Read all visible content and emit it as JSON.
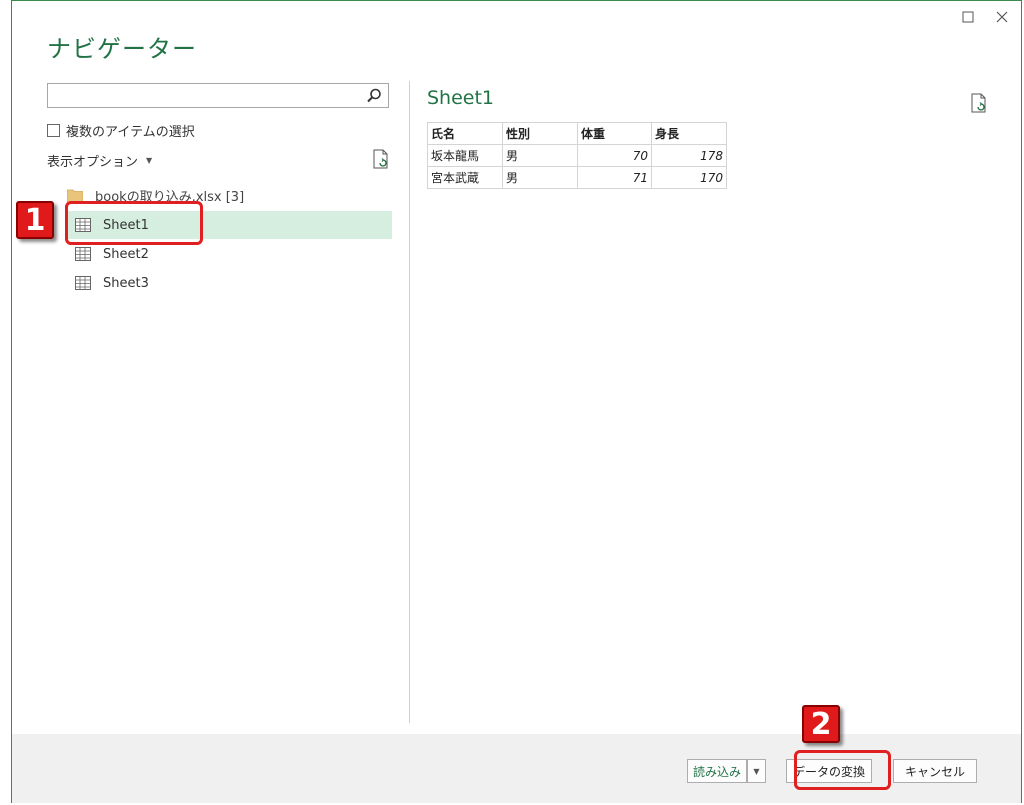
{
  "dialog": {
    "title": "ナビゲーター"
  },
  "left_panel": {
    "search_placeholder": "",
    "multi_select_label": "複数のアイテムの選択",
    "display_options_label": "表示オプション",
    "file_node": "bookの取り込み.xlsx [3]",
    "items": [
      {
        "label": "Sheet1",
        "selected": true
      },
      {
        "label": "Sheet2",
        "selected": false
      },
      {
        "label": "Sheet3",
        "selected": false
      }
    ]
  },
  "preview": {
    "title": "Sheet1",
    "columns": [
      "氏名",
      "性別",
      "体重",
      "身長"
    ],
    "rows": [
      [
        "坂本龍馬",
        "男",
        "70",
        "178"
      ],
      [
        "宮本武蔵",
        "男",
        "71",
        "170"
      ]
    ]
  },
  "footer": {
    "load_label": "読み込み",
    "transform_label": "データの変換",
    "cancel_label": "キャンセル"
  },
  "annotations": {
    "badge1": "1",
    "badge2": "2"
  },
  "colors": {
    "accent": "#217346",
    "selected_bg": "#d6eee0",
    "callout": "#e02020",
    "footer_bg": "#f0f0f0"
  }
}
